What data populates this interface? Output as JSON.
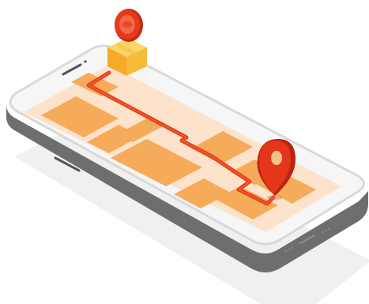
{
  "illustration": {
    "subject": "delivery-route-on-smartphone",
    "icons": [
      "package-icon",
      "location-pin-icon",
      "route-line",
      "smartphone"
    ],
    "colors": {
      "phone_body": "#f6f6f6",
      "phone_edge": "#d9d9d9",
      "phone_side": "#6e6e6e",
      "shadow": "#e6e6e6",
      "screen_bg": "#fde3cc",
      "map_block": "#f6ab5a",
      "map_road": "#fde3cc",
      "route": "#e8411d",
      "route_highlight": "#f26a3a",
      "package_top": "#fdd766",
      "package_left": "#f7a928",
      "package_right": "#f7bb3a",
      "badge": "#e73a1d",
      "badge_light": "#f06a45",
      "pin": "#e3361b",
      "pin_dark": "#b8260f",
      "pin_hole": "#f9c18a"
    }
  }
}
